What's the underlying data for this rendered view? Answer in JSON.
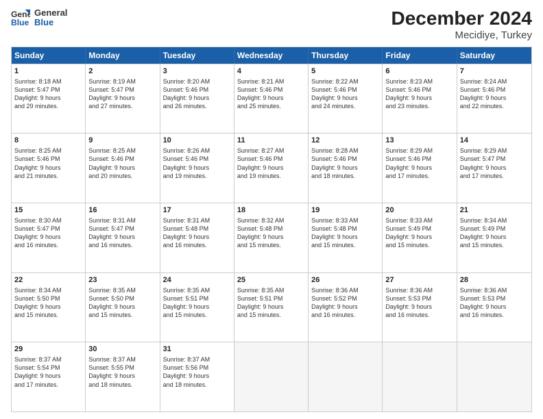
{
  "logo": {
    "line1": "General",
    "line2": "Blue"
  },
  "title": "December 2024",
  "subtitle": "Mecidiye, Turkey",
  "days": [
    "Sunday",
    "Monday",
    "Tuesday",
    "Wednesday",
    "Thursday",
    "Friday",
    "Saturday"
  ],
  "weeks": [
    [
      {
        "num": "1",
        "info": "Sunrise: 8:18 AM\nSunset: 5:47 PM\nDaylight: 9 hours\nand 29 minutes."
      },
      {
        "num": "2",
        "info": "Sunrise: 8:19 AM\nSunset: 5:47 PM\nDaylight: 9 hours\nand 27 minutes."
      },
      {
        "num": "3",
        "info": "Sunrise: 8:20 AM\nSunset: 5:46 PM\nDaylight: 9 hours\nand 26 minutes."
      },
      {
        "num": "4",
        "info": "Sunrise: 8:21 AM\nSunset: 5:46 PM\nDaylight: 9 hours\nand 25 minutes."
      },
      {
        "num": "5",
        "info": "Sunrise: 8:22 AM\nSunset: 5:46 PM\nDaylight: 9 hours\nand 24 minutes."
      },
      {
        "num": "6",
        "info": "Sunrise: 8:23 AM\nSunset: 5:46 PM\nDaylight: 9 hours\nand 23 minutes."
      },
      {
        "num": "7",
        "info": "Sunrise: 8:24 AM\nSunset: 5:46 PM\nDaylight: 9 hours\nand 22 minutes."
      }
    ],
    [
      {
        "num": "8",
        "info": "Sunrise: 8:25 AM\nSunset: 5:46 PM\nDaylight: 9 hours\nand 21 minutes."
      },
      {
        "num": "9",
        "info": "Sunrise: 8:25 AM\nSunset: 5:46 PM\nDaylight: 9 hours\nand 20 minutes."
      },
      {
        "num": "10",
        "info": "Sunrise: 8:26 AM\nSunset: 5:46 PM\nDaylight: 9 hours\nand 19 minutes."
      },
      {
        "num": "11",
        "info": "Sunrise: 8:27 AM\nSunset: 5:46 PM\nDaylight: 9 hours\nand 19 minutes."
      },
      {
        "num": "12",
        "info": "Sunrise: 8:28 AM\nSunset: 5:46 PM\nDaylight: 9 hours\nand 18 minutes."
      },
      {
        "num": "13",
        "info": "Sunrise: 8:29 AM\nSunset: 5:46 PM\nDaylight: 9 hours\nand 17 minutes."
      },
      {
        "num": "14",
        "info": "Sunrise: 8:29 AM\nSunset: 5:47 PM\nDaylight: 9 hours\nand 17 minutes."
      }
    ],
    [
      {
        "num": "15",
        "info": "Sunrise: 8:30 AM\nSunset: 5:47 PM\nDaylight: 9 hours\nand 16 minutes."
      },
      {
        "num": "16",
        "info": "Sunrise: 8:31 AM\nSunset: 5:47 PM\nDaylight: 9 hours\nand 16 minutes."
      },
      {
        "num": "17",
        "info": "Sunrise: 8:31 AM\nSunset: 5:48 PM\nDaylight: 9 hours\nand 16 minutes."
      },
      {
        "num": "18",
        "info": "Sunrise: 8:32 AM\nSunset: 5:48 PM\nDaylight: 9 hours\nand 15 minutes."
      },
      {
        "num": "19",
        "info": "Sunrise: 8:33 AM\nSunset: 5:48 PM\nDaylight: 9 hours\nand 15 minutes."
      },
      {
        "num": "20",
        "info": "Sunrise: 8:33 AM\nSunset: 5:49 PM\nDaylight: 9 hours\nand 15 minutes."
      },
      {
        "num": "21",
        "info": "Sunrise: 8:34 AM\nSunset: 5:49 PM\nDaylight: 9 hours\nand 15 minutes."
      }
    ],
    [
      {
        "num": "22",
        "info": "Sunrise: 8:34 AM\nSunset: 5:50 PM\nDaylight: 9 hours\nand 15 minutes."
      },
      {
        "num": "23",
        "info": "Sunrise: 8:35 AM\nSunset: 5:50 PM\nDaylight: 9 hours\nand 15 minutes."
      },
      {
        "num": "24",
        "info": "Sunrise: 8:35 AM\nSunset: 5:51 PM\nDaylight: 9 hours\nand 15 minutes."
      },
      {
        "num": "25",
        "info": "Sunrise: 8:35 AM\nSunset: 5:51 PM\nDaylight: 9 hours\nand 15 minutes."
      },
      {
        "num": "26",
        "info": "Sunrise: 8:36 AM\nSunset: 5:52 PM\nDaylight: 9 hours\nand 16 minutes."
      },
      {
        "num": "27",
        "info": "Sunrise: 8:36 AM\nSunset: 5:53 PM\nDaylight: 9 hours\nand 16 minutes."
      },
      {
        "num": "28",
        "info": "Sunrise: 8:36 AM\nSunset: 5:53 PM\nDaylight: 9 hours\nand 16 minutes."
      }
    ],
    [
      {
        "num": "29",
        "info": "Sunrise: 8:37 AM\nSunset: 5:54 PM\nDaylight: 9 hours\nand 17 minutes."
      },
      {
        "num": "30",
        "info": "Sunrise: 8:37 AM\nSunset: 5:55 PM\nDaylight: 9 hours\nand 18 minutes."
      },
      {
        "num": "31",
        "info": "Sunrise: 8:37 AM\nSunset: 5:56 PM\nDaylight: 9 hours\nand 18 minutes."
      },
      {
        "num": "",
        "info": ""
      },
      {
        "num": "",
        "info": ""
      },
      {
        "num": "",
        "info": ""
      },
      {
        "num": "",
        "info": ""
      }
    ]
  ]
}
